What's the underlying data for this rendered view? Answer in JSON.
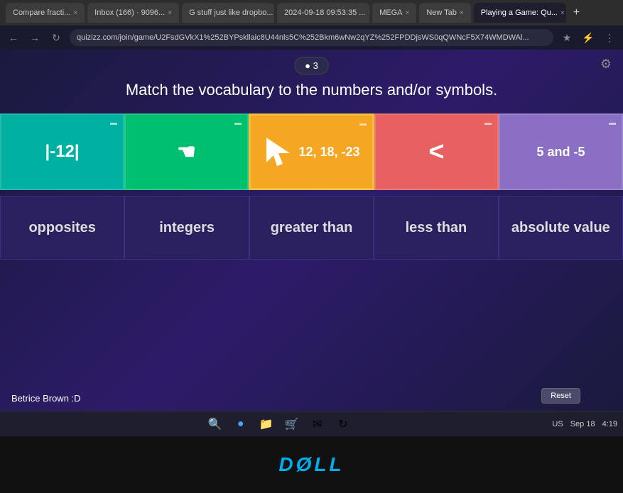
{
  "browser": {
    "tabs": [
      {
        "label": "Compare fracti...",
        "active": false
      },
      {
        "label": "Inbox (166) · 9096...",
        "active": false
      },
      {
        "label": "G stuff just like dropbo...",
        "active": false
      },
      {
        "label": "2024-09-18 09:53:35 ...",
        "active": false
      },
      {
        "label": "MEGA",
        "active": false
      },
      {
        "label": "New Tab",
        "active": false
      },
      {
        "label": "Playing a Game: Qu...",
        "active": true
      }
    ],
    "url": "quizizz.com/join/game/U2FsdGVkX1%252BYPskllaic8U44nls5C%252Bkm6wNw2qYZ%252FPDDjsWS0qQWNcF5X74WMDWAl..."
  },
  "game": {
    "score": "● 3",
    "instruction": "Match the vocabulary to the numbers and/or symbols.",
    "top_cards": [
      {
        "id": "card-1",
        "content": "|-12|",
        "type": "text",
        "color": "teal"
      },
      {
        "id": "card-2",
        "content": "✋",
        "type": "hand",
        "color": "green"
      },
      {
        "id": "card-3",
        "content": "12, 18, -23",
        "type": "text",
        "color": "orange"
      },
      {
        "id": "card-4",
        "content": "<",
        "type": "text",
        "color": "salmon"
      },
      {
        "id": "card-5",
        "content": "5 and -5",
        "type": "text",
        "color": "purple"
      }
    ],
    "word_cards": [
      {
        "id": "word-1",
        "label": "opposites"
      },
      {
        "id": "word-2",
        "label": "integers"
      },
      {
        "id": "word-3",
        "label": "greater than"
      },
      {
        "id": "word-4",
        "label": "less than"
      },
      {
        "id": "word-5",
        "label": "absolute value"
      }
    ],
    "player": "Betrice Brown :D",
    "reset_label": "Reset"
  },
  "taskbar": {
    "time": "4:19",
    "date": "Sep 18",
    "language": "US"
  },
  "dell": {
    "logo": "DØLL"
  }
}
